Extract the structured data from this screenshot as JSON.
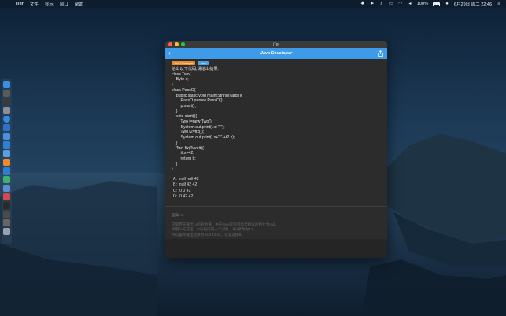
{
  "menubar": {
    "app_name": "iTer",
    "menus": [
      "文件",
      "显示",
      "窗口",
      "帮助"
    ],
    "battery": "100%",
    "datetime": "6月29日 周二 22:46"
  },
  "window": {
    "title": "iTer",
    "nav_title": "Java Developer",
    "tags": [
      "Java Developer",
      "Java"
    ],
    "question_lines": [
      "给出以下代码,请给出结果.",
      "class Two{",
      "    Byte x;",
      "}",
      "class PassO{",
      "    public static void main(String[] args){",
      "        PassO p=new PassO();",
      "        p.start();",
      "    }",
      "    void start(){",
      "        Two t=new Two();",
      "        System.out.print(t.x+\" \");",
      "        Two t2=fix(t);",
      "        System.out.print(t.x+\" \" +t2.x);",
      "    }",
      "    Two fix(Two tt){",
      "        tt.x=42;",
      "        return tt;",
      "    }",
      "}"
    ],
    "options": [
      "A:  null null 42",
      "B:  null 42 42",
      "C:  0 0 42",
      "D:  0 42 42"
    ],
    "answer": "答案:  B",
    "explanation_lines": [
      "这里首先输出t.x的初始值，由于Byte是包装类型所以初始化为null。",
      "调用fix方法后，tt与t指向同一个对象，将x修改为42。",
      "所以最终输出结果为 null 42 42，答案选择B。"
    ]
  }
}
